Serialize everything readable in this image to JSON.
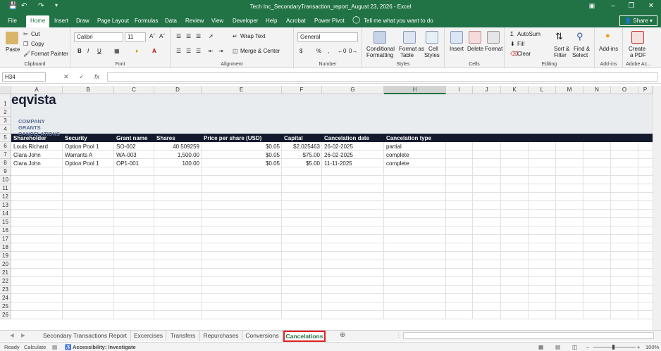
{
  "window": {
    "title": "Tech Inc_SecondaryTransaction_report_August 23, 2026  -  Excel"
  },
  "menu": {
    "tabs": [
      "File",
      "Home",
      "Insert",
      "Draw",
      "Page Layout",
      "Formulas",
      "Data",
      "Review",
      "View",
      "Developer",
      "Help",
      "Acrobat",
      "Power Pivot"
    ],
    "tell_me": "Tell me what you want to do",
    "share": "Share"
  },
  "ribbon": {
    "clipboard": {
      "label": "Clipboard",
      "paste": "Paste",
      "cut": "Cut",
      "copy": "Copy",
      "format_painter": "Format Painter"
    },
    "font": {
      "label": "Font",
      "name": "Calibri",
      "size": "11",
      "bold": "B",
      "italic": "I",
      "underline": "U"
    },
    "alignment": {
      "label": "Alignment",
      "wrap": "Wrap Text",
      "merge": "Merge & Center"
    },
    "number": {
      "label": "Number",
      "format": "General",
      "currency": "$",
      "percent": "%",
      "comma": ","
    },
    "styles": {
      "label": "Styles",
      "conditional": "Conditional",
      "conditional2": "Formatting",
      "format_table": "Format as",
      "format_table2": "Table",
      "cell_styles": "Cell",
      "cell_styles2": "Styles"
    },
    "cells": {
      "label": "Cells",
      "insert": "Insert",
      "delete": "Delete",
      "format": "Format"
    },
    "editing": {
      "label": "Editing",
      "autosum": "AutoSum",
      "fill": "Fill",
      "clear": "Clear",
      "sort": "Sort &",
      "sort2": "Filter",
      "find": "Find &",
      "find2": "Select"
    },
    "addins": {
      "label": "Add-ins",
      "addins": "Add-ins"
    },
    "adobe": {
      "label": "Adobe Ac...",
      "create": "Create",
      "create2": "a PDF"
    }
  },
  "formula_bar": {
    "name_box": "H34",
    "fx": "fx",
    "value": ""
  },
  "columns": [
    "A",
    "B",
    "C",
    "D",
    "E",
    "F",
    "G",
    "H",
    "I",
    "J",
    "K",
    "L",
    "M",
    "N",
    "O",
    "P"
  ],
  "rows": [
    "1",
    "2",
    "3",
    "4",
    "5",
    "6",
    "7",
    "8",
    "9",
    "10",
    "11",
    "12",
    "13",
    "14",
    "15",
    "16",
    "17",
    "18",
    "19",
    "20",
    "21",
    "22",
    "23",
    "24",
    "25",
    "26"
  ],
  "sheet": {
    "brand": "eqvista",
    "subtitle": "COMPANY GRANTS CANCELATIONS",
    "headers": [
      "Shareholder",
      "Security",
      "Grant name",
      "Shares",
      "Price per share (USD)",
      "Capital",
      "Cancelation date",
      "Cancelation type"
    ],
    "data": [
      [
        "Louis Richard",
        "Option Pool 1",
        "SO-002",
        "40.509259",
        "$0.05",
        "$2.025463",
        "26-02-2025",
        "partial"
      ],
      [
        "Clara John",
        "Warrants A",
        "WA-003",
        "1,500.00",
        "$0.05",
        "$75.00",
        "26-02-2025",
        "complete"
      ],
      [
        "Clara John",
        "Option Pool 1",
        "OP1-001",
        "100.00",
        "$0.05",
        "$5.00",
        "11-11-2025",
        "complete"
      ]
    ]
  },
  "sheet_tabs": [
    "Secondary Transactions Report",
    "Excercises",
    "Transfers",
    "Repurchases",
    "Conversions",
    "Cancelations"
  ],
  "active_sheet": "Cancelations",
  "status": {
    "ready": "Ready",
    "calculate": "Calculate",
    "accessibility": "Accessibility: Investigate",
    "zoom": "100%"
  },
  "colors": {
    "excel_green": "#217346",
    "header_band": "#141a2e",
    "title_band": "#e9ecef",
    "subtitle": "#5b6f95",
    "active_tab_outline": "#e02020"
  }
}
